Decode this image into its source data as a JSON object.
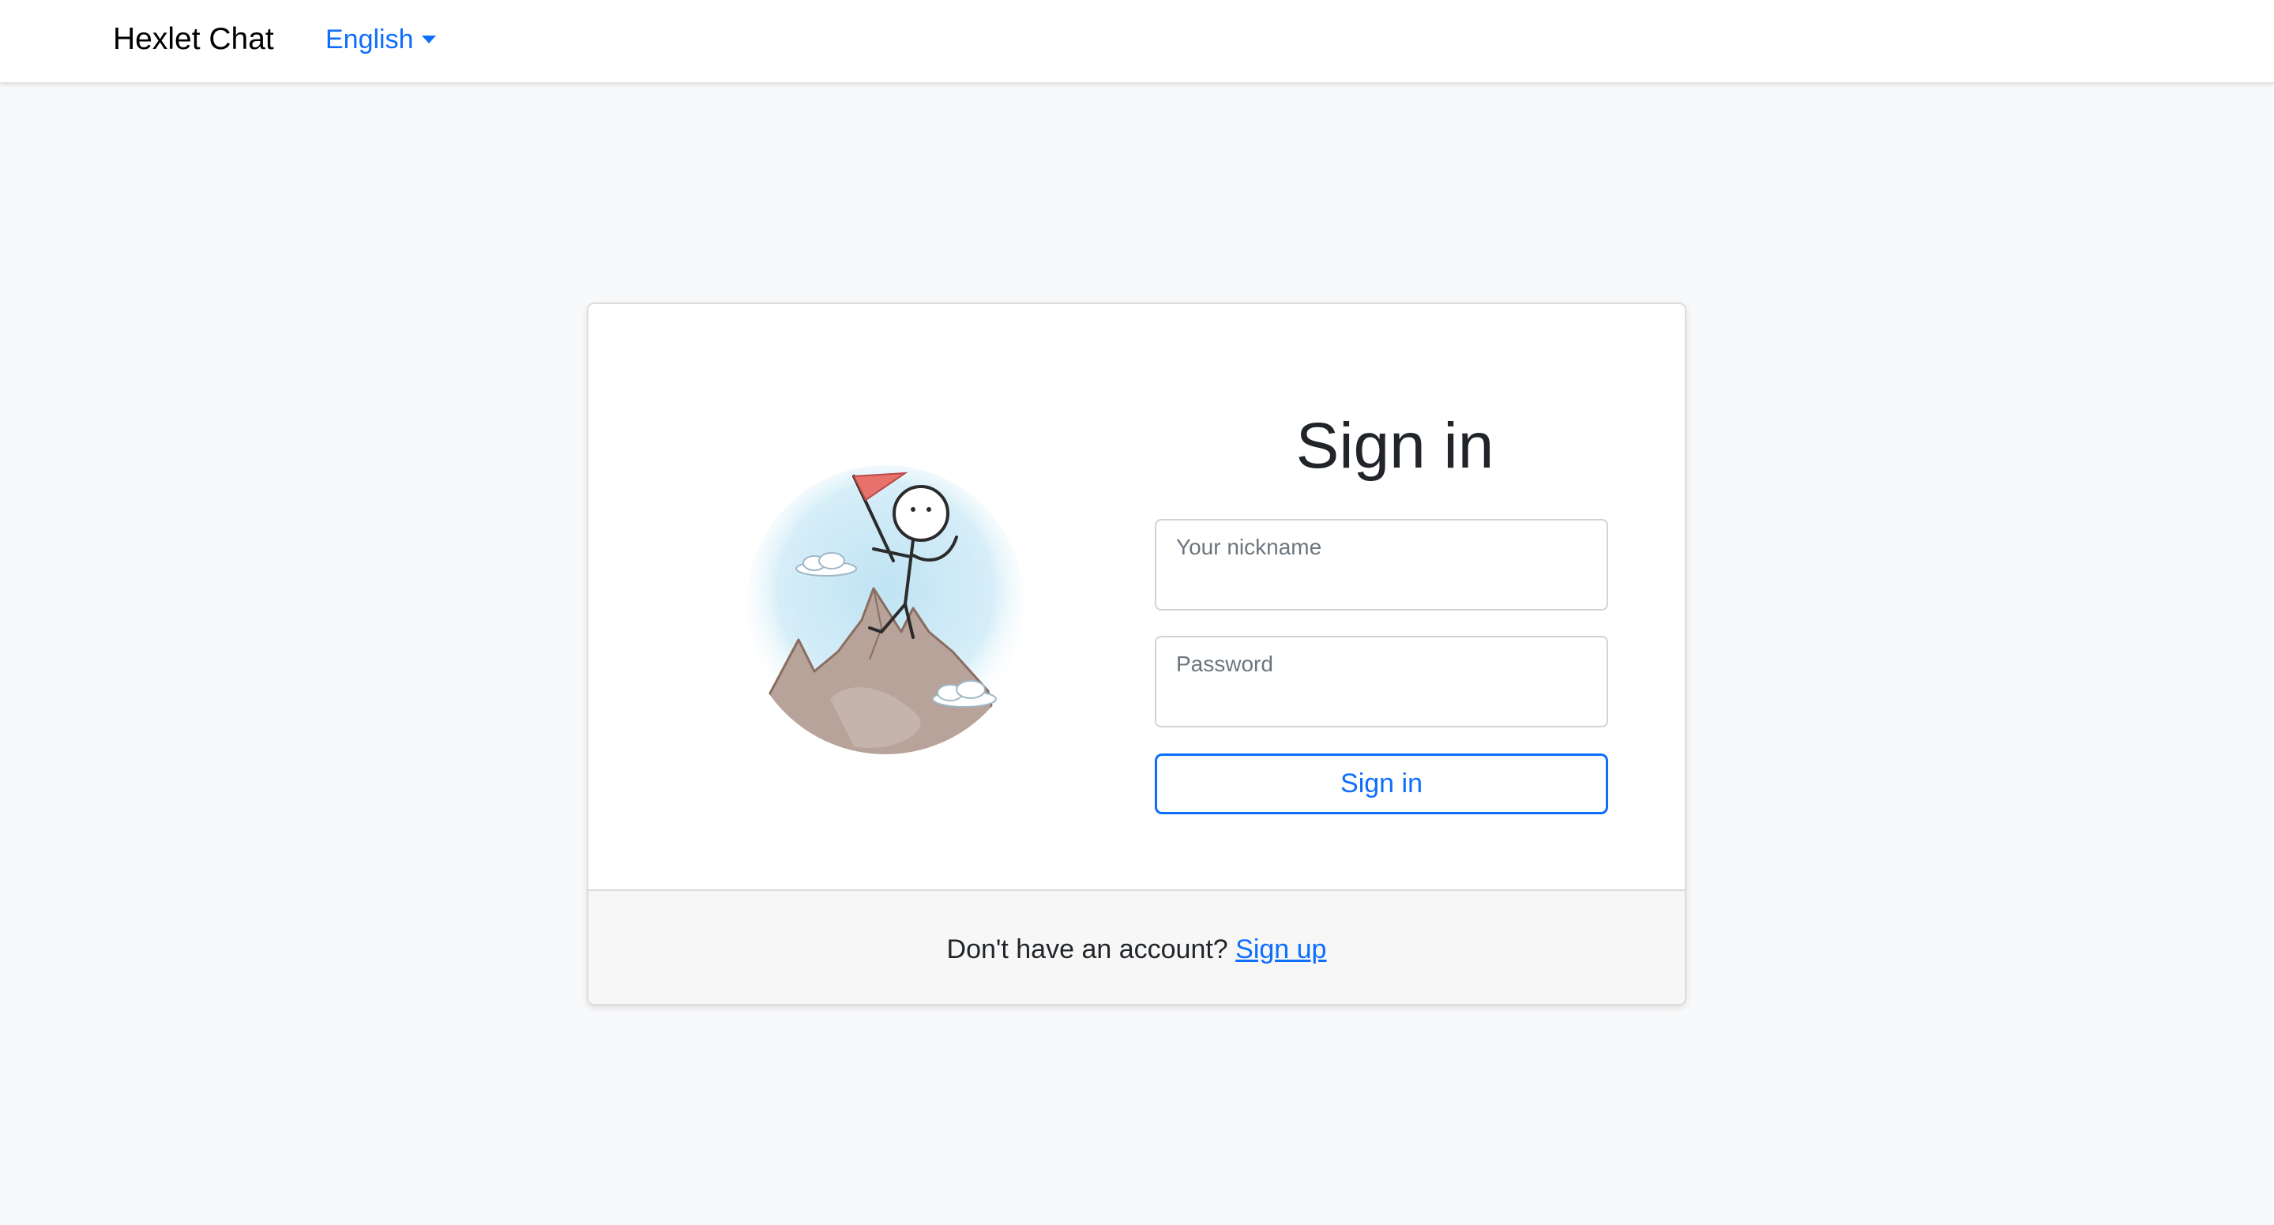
{
  "navbar": {
    "brand": "Hexlet Chat",
    "language": "English"
  },
  "login": {
    "title": "Sign in",
    "nickname_label": "Your nickname",
    "nickname_value": "",
    "password_label": "Password",
    "password_value": "",
    "submit_label": "Sign in",
    "illustration": "climber-on-mountain-illustration"
  },
  "footer": {
    "prompt": "Don't have an account?",
    "signup_link": "Sign up"
  },
  "colors": {
    "accent": "#0d6efd",
    "background": "#f8f9fa",
    "flag": "#e8716c"
  }
}
